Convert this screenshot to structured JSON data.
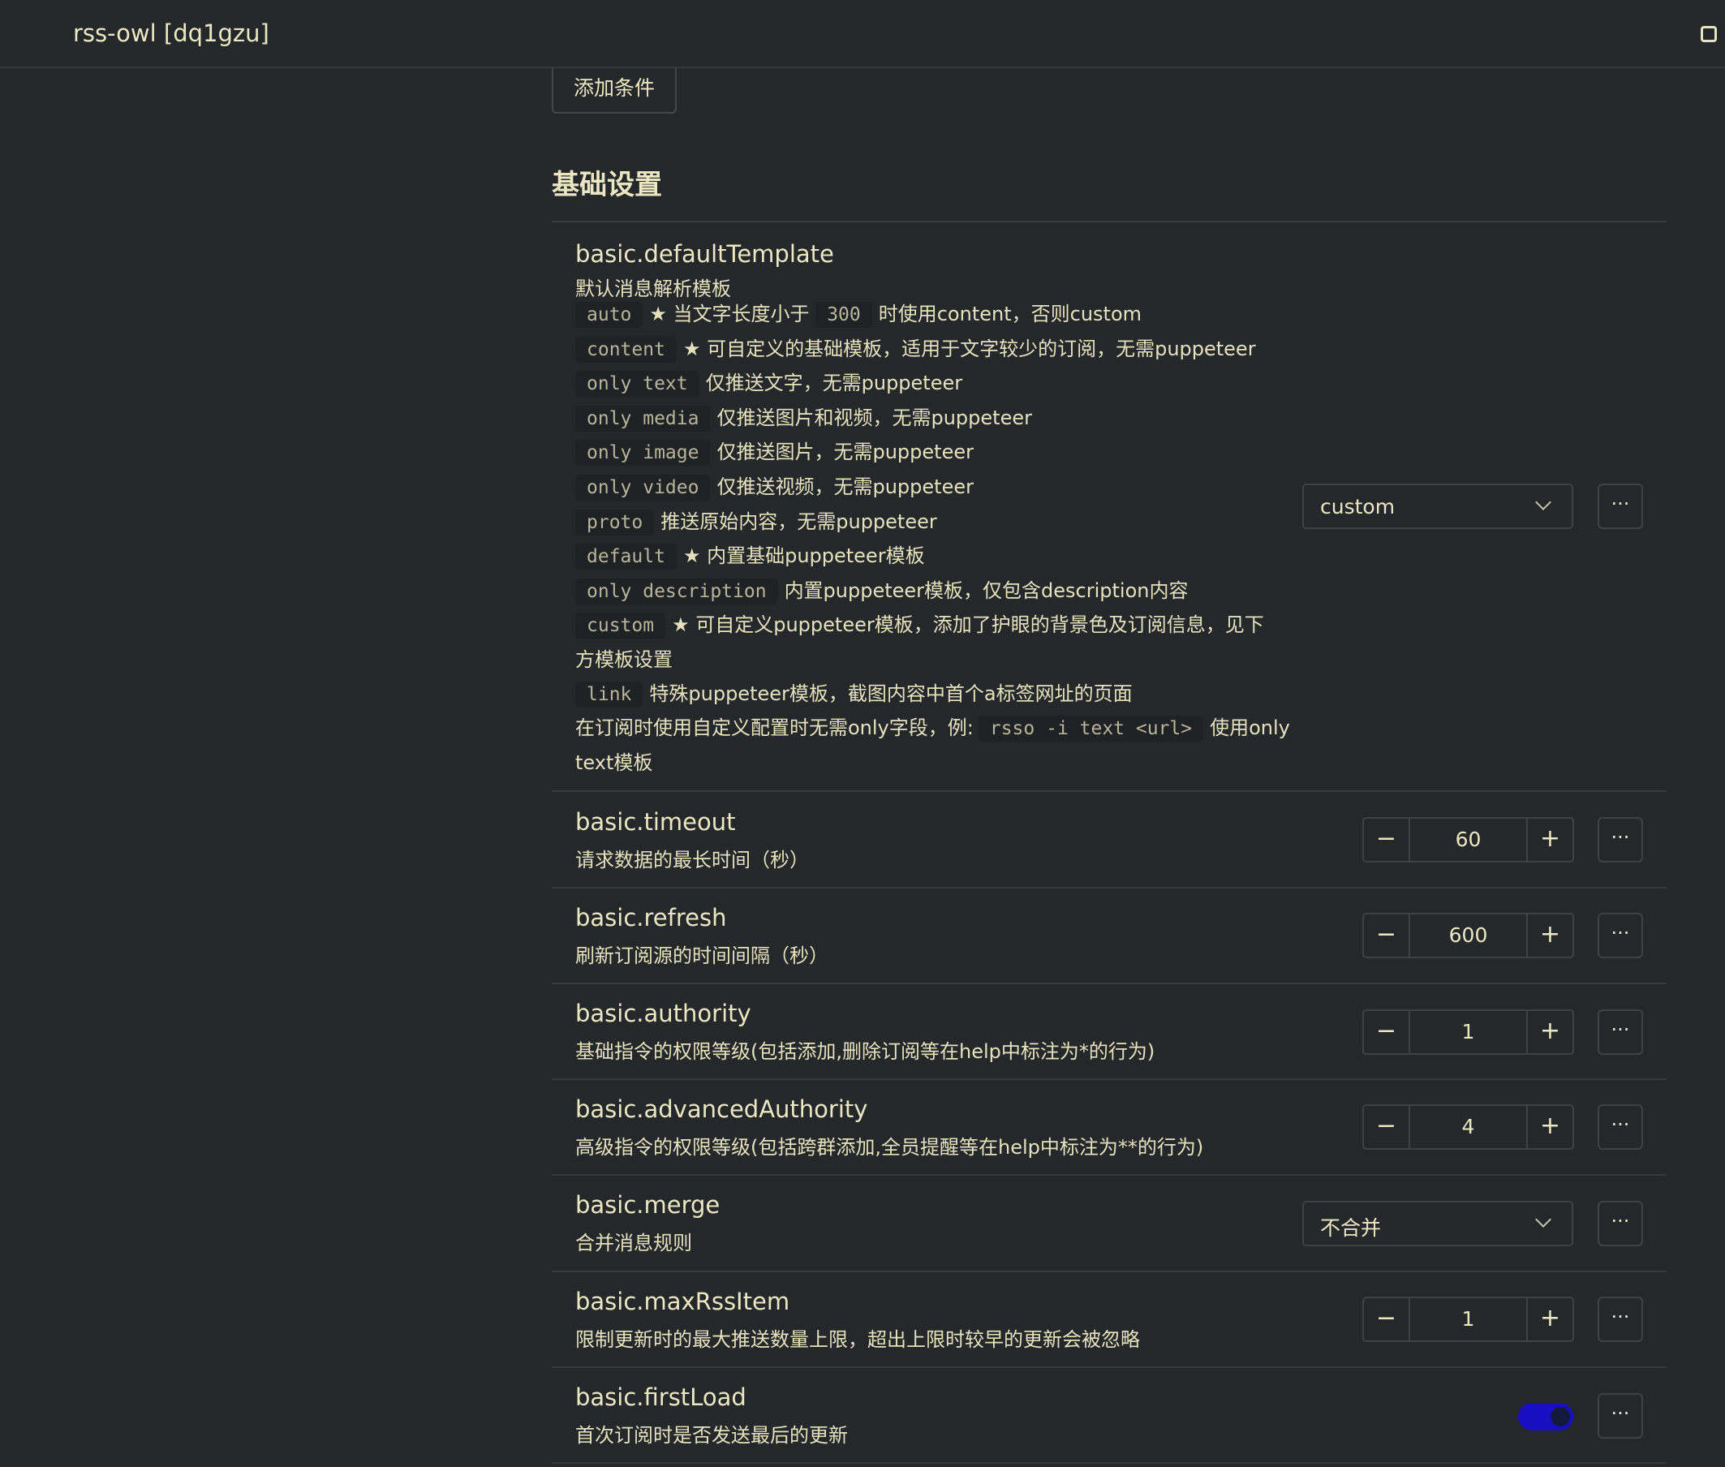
{
  "window": {
    "title": "rss-owl [dq1gzu]"
  },
  "toolbar": {
    "add_condition": "添加条件"
  },
  "section": {
    "title": "基础设置"
  },
  "rows": {
    "defaultTemplate": {
      "title": "basic.defaultTemplate",
      "desc": "默认消息解析模板",
      "options": [
        {
          "code": "auto",
          "pre": "★ 当文字长度小于",
          "code2": "300",
          "post": "时使用content，否则custom"
        },
        {
          "code": "content",
          "text": "★ 可自定义的基础模板，适用于文字较少的订阅，无需puppeteer"
        },
        {
          "code": "only text",
          "text": "仅推送文字，无需puppeteer"
        },
        {
          "code": "only media",
          "text": "仅推送图片和视频，无需puppeteer"
        },
        {
          "code": "only image",
          "text": "仅推送图片，无需puppeteer"
        },
        {
          "code": "only video",
          "text": "仅推送视频，无需puppeteer"
        },
        {
          "code": "proto",
          "text": "推送原始内容，无需puppeteer"
        },
        {
          "code": "default",
          "text": "★ 内置基础puppeteer模板"
        },
        {
          "code": "only description",
          "text": "内置puppeteer模板，仅包含description内容"
        },
        {
          "code": "custom",
          "text": "★ 可自定义puppeteer模板，添加了护眼的背景色及订阅信息，见下"
        },
        {
          "text": "方模板设置"
        },
        {
          "code": "link",
          "text": "特殊puppeteer模板，截图内容中首个a标签网址的页面"
        }
      ],
      "note_pre": "在订阅时使用自定义配置时无需only字段，例:",
      "note_code": "rsso -i text <url>",
      "note_post": "使用only",
      "note_cont": "text模板",
      "value": "custom"
    },
    "timeout": {
      "title": "basic.timeout",
      "desc": "请求数据的最长时间（秒）",
      "value": "60"
    },
    "refresh": {
      "title": "basic.refresh",
      "desc": "刷新订阅源的时间间隔（秒）",
      "value": "600"
    },
    "authority": {
      "title": "basic.authority",
      "desc": "基础指令的权限等级(包括添加,删除订阅等在help中标注为*的行为)",
      "value": "1"
    },
    "advancedAuthority": {
      "title": "basic.advancedAuthority",
      "desc": "高级指令的权限等级(包括跨群添加,全员提醒等在help中标注为**的行为)",
      "value": "4"
    },
    "merge": {
      "title": "basic.merge",
      "desc": "合并消息规则",
      "value": "不合并"
    },
    "maxRssItem": {
      "title": "basic.maxRssItem",
      "desc": "限制更新时的最大推送数量上限，超出上限时较早的更新会被忽略",
      "value": "1"
    },
    "firstLoad": {
      "title": "basic.firstLoad",
      "desc": "首次订阅时是否发送最后的更新",
      "enabled": true
    }
  },
  "controls": {
    "minus": "−",
    "plus": "+",
    "more": "···"
  },
  "colors": {
    "background": "#25282b",
    "text": "#ece7c2",
    "toggle_on": "#1a0ec2"
  }
}
